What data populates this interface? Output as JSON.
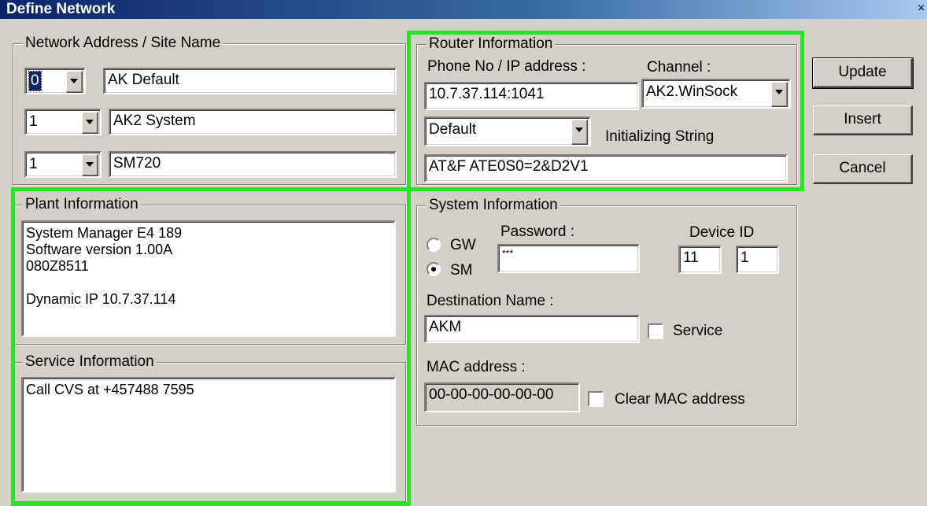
{
  "window": {
    "title": "Define Network",
    "close_glyph": "×"
  },
  "network": {
    "legend": "Network Address / Site Name",
    "rows": [
      {
        "combo": "0",
        "name": "AK Default"
      },
      {
        "combo": "1",
        "name": "AK2 System"
      },
      {
        "combo": "1",
        "name": "SM720"
      }
    ]
  },
  "router": {
    "legend": "Router Information",
    "phone_label": "Phone No / IP address :",
    "channel_label": "Channel :",
    "phone_value": "10.7.37.114:1041",
    "channel_value": "AK2.WinSock",
    "profile_value": "Default",
    "init_label": "Initializing String",
    "init_value": "AT&F ATE0S0=2&D2V1"
  },
  "buttons": {
    "update": "Update",
    "insert": "Insert",
    "cancel": "Cancel"
  },
  "plant": {
    "legend": "Plant Information",
    "text": "System Manager E4 189\nSoftware version 1.00A\n080Z8511\n\nDynamic IP 10.7.37.114"
  },
  "service_info": {
    "legend": "Service Information",
    "text": "Call CVS at +457488 7595"
  },
  "system": {
    "legend": "System Information",
    "radio_gw": "GW",
    "radio_sm": "SM",
    "selected": "SM",
    "password_label": "Password :",
    "password_value": "***",
    "device_id_label": "Device ID",
    "device_id_1": "11",
    "device_id_2": "1",
    "destination_label": "Destination Name :",
    "destination_value": "AKM",
    "service_checkbox_label": "Service",
    "service_checked": false,
    "mac_label": "MAC address :",
    "mac_value": "00-00-00-00-00-00",
    "clear_mac_label": "Clear MAC address",
    "clear_mac_checked": false
  },
  "colors": {
    "highlight": "#23e523",
    "title_bar": "#0a246a",
    "face": "#d4d0c8"
  }
}
